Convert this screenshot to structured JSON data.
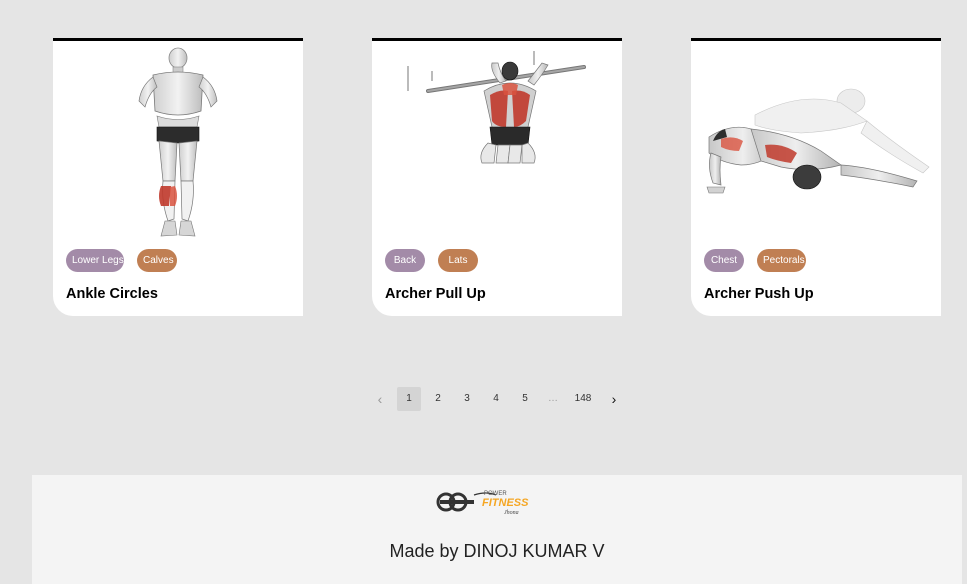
{
  "exercises": [
    {
      "title": "Ankle Circles",
      "body_part": "Lower Legs",
      "target": "Calves",
      "image": "ankle-circles-illustration"
    },
    {
      "title": "Archer Pull Up",
      "body_part": "Back",
      "target": "Lats",
      "image": "archer-pull-up-illustration"
    },
    {
      "title": "Archer Push Up",
      "body_part": "Chest",
      "target": "Pectorals",
      "image": "archer-push-up-illustration"
    }
  ],
  "colors": {
    "body_chip": "#a38ba8",
    "target_chip": "#c07f53",
    "muscle_highlight": "#c0392b",
    "logo_accent": "#f5a623"
  },
  "pagination": {
    "prev_icon": "chevron-left-icon",
    "next_icon": "chevron-right-icon",
    "pages": [
      "1",
      "2",
      "3",
      "4",
      "5"
    ],
    "ellipsis": "…",
    "last_page": "148",
    "current_page": "1"
  },
  "footer": {
    "logo": {
      "top": "POWER",
      "main": "FITNESS",
      "sub": "Jhona"
    },
    "credit": "Made by DINOJ KUMAR V"
  }
}
